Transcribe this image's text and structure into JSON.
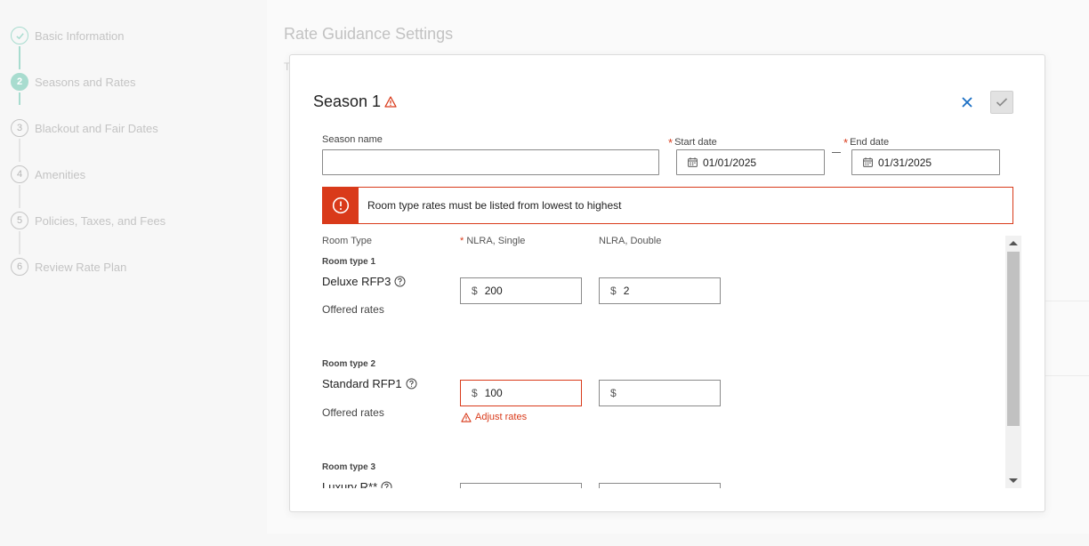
{
  "sidebar": {
    "steps": [
      {
        "number": "",
        "label": "Basic Information",
        "state": "done"
      },
      {
        "number": "2",
        "label": "Seasons and Rates",
        "state": "active"
      },
      {
        "number": "3",
        "label": "Blackout and Fair Dates",
        "state": "pending"
      },
      {
        "number": "4",
        "label": "Amenities",
        "state": "pending"
      },
      {
        "number": "5",
        "label": "Policies, Taxes, and Fees",
        "state": "pending"
      },
      {
        "number": "6",
        "label": "Review Rate Plan",
        "state": "pending"
      }
    ]
  },
  "background": {
    "title": "Rate Guidance Settings",
    "text_fragment": "T"
  },
  "modal": {
    "title": "Season 1",
    "season_name_label": "Season name",
    "season_name_value": "",
    "start_date_label": "Start date",
    "start_date_value": "01/01/2025",
    "end_date_label": "End date",
    "end_date_value": "01/31/2025",
    "required_mark": "*",
    "alert_text": "Room type rates must be listed from lowest to highest",
    "columns": {
      "room_type": "Room Type",
      "single_required_mark": "*",
      "single": "NLRA, Single",
      "double": "NLRA, Double"
    },
    "currency": "$",
    "rooms": [
      {
        "type_label": "Room type 1",
        "name": "Deluxe RFP3",
        "offered": "Offered rates",
        "single": "200",
        "double": "2",
        "error": ""
      },
      {
        "type_label": "Room type 2",
        "name": "Standard RFP1",
        "offered": "Offered rates",
        "single": "100",
        "double": "",
        "error": "Adjust rates"
      },
      {
        "type_label": "Room type 3",
        "name": "Luxury R**",
        "offered": "",
        "single": "",
        "double": "",
        "error": ""
      }
    ]
  },
  "colors": {
    "accent_teal": "#a8dccf",
    "error_red": "#d93a1a",
    "close_blue": "#1a6fc4"
  }
}
